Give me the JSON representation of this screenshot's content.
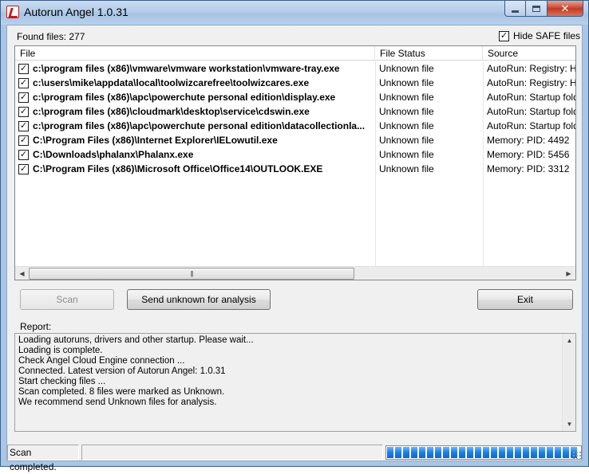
{
  "window": {
    "title": "Autorun Angel 1.0.31",
    "buttons": {
      "minimize": "minimize",
      "maximize": "maximize",
      "close": "✕"
    }
  },
  "top": {
    "found_files": "Found files: 277",
    "hide_safe_label": "Hide SAFE files",
    "hide_safe_checked": true
  },
  "list": {
    "columns": [
      "File",
      "File Status",
      "Source"
    ],
    "rows": [
      {
        "checked": "✓",
        "file": "c:\\program files (x86)\\vmware\\vmware workstation\\vmware-tray.exe",
        "status": "Unknown file",
        "source": "AutoRun: Registry: HKLM"
      },
      {
        "checked": "✓",
        "file": "c:\\users\\mike\\appdata\\local\\toolwizcarefree\\toolwizcares.exe",
        "status": "Unknown file",
        "source": "AutoRun: Registry: HKCU"
      },
      {
        "checked": "✓",
        "file": "c:\\program files (x86)\\apc\\powerchute personal edition\\display.exe",
        "status": "Unknown file",
        "source": "AutoRun: Startup folder"
      },
      {
        "checked": "✓",
        "file": "c:\\program files (x86)\\cloudmark\\desktop\\service\\cdswin.exe",
        "status": "Unknown file",
        "source": "AutoRun: Startup folder"
      },
      {
        "checked": "✓",
        "file": "c:\\program files (x86)\\apc\\powerchute personal edition\\datacollectionla...",
        "status": "Unknown file",
        "source": "AutoRun: Startup folder"
      },
      {
        "checked": "✓",
        "file": "C:\\Program Files (x86)\\Internet Explorer\\IELowutil.exe",
        "status": "Unknown file",
        "source": "Memory: PID: 4492"
      },
      {
        "checked": "✓",
        "file": "C:\\Downloads\\phalanx\\Phalanx.exe",
        "status": "Unknown file",
        "source": "Memory: PID: 5456"
      },
      {
        "checked": "✓",
        "file": "C:\\Program Files (x86)\\Microsoft Office\\Office14\\OUTLOOK.EXE",
        "status": "Unknown file",
        "source": "Memory: PID: 3312"
      }
    ],
    "scroll_left": "◀",
    "scroll_right": "▶",
    "scroll_thumb_grip": "|||"
  },
  "buttons": {
    "scan": "Scan",
    "send": "Send unknown for analysis",
    "exit": "Exit"
  },
  "report": {
    "label": "Report:",
    "lines": [
      "Loading autoruns, drivers and other startup. Please wait...",
      "Loading is complete.",
      "Check Angel Cloud Engine connection ...",
      "Connected. Latest version of Autorun Angel: 1.0.31",
      "Start checking files ...",
      "Scan completed. 8 files were marked as Unknown.",
      "We recommend send Unknown files for analysis."
    ],
    "scroll_up": "▲",
    "scroll_down": "▼"
  },
  "status": {
    "text": "Scan completed.",
    "progress_fraction": 1.0
  }
}
